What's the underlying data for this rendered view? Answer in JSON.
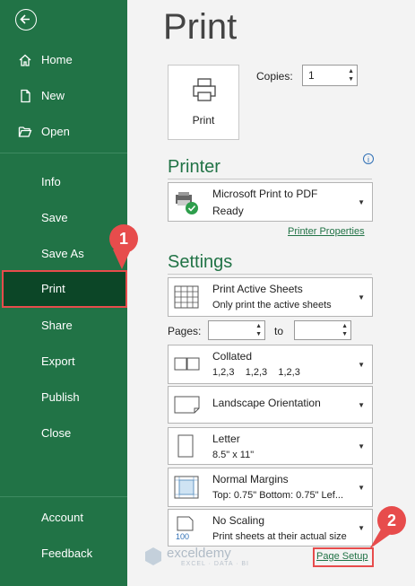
{
  "sidebar": {
    "back": "back",
    "items": [
      {
        "label": "Home",
        "icon": "home-icon"
      },
      {
        "label": "New",
        "icon": "new-document-icon"
      },
      {
        "label": "Open",
        "icon": "folder-open-icon"
      },
      {
        "label": "Info"
      },
      {
        "label": "Save"
      },
      {
        "label": "Save As"
      },
      {
        "label": "Print",
        "active": true
      },
      {
        "label": "Share"
      },
      {
        "label": "Export"
      },
      {
        "label": "Publish"
      },
      {
        "label": "Close"
      },
      {
        "label": "Account"
      },
      {
        "label": "Feedback"
      }
    ]
  },
  "main": {
    "title": "Print",
    "print_button": "Print",
    "copies_label": "Copies:",
    "copies_value": "1",
    "printer_heading": "Printer",
    "printer_name": "Microsoft Print to PDF",
    "printer_status": "Ready",
    "printer_properties": "Printer Properties",
    "settings_heading": "Settings",
    "settings": [
      {
        "line1": "Print Active Sheets",
        "line2": "Only print the active sheets"
      },
      {
        "line1": "Collated",
        "line2": "1,2,3    1,2,3    1,2,3"
      },
      {
        "line1": "Landscape Orientation",
        "line2": ""
      },
      {
        "line1": "Letter",
        "line2": "8.5\" x 11\""
      },
      {
        "line1": "Normal Margins",
        "line2": "Top: 0.75\" Bottom: 0.75\" Lef..."
      },
      {
        "line1": "No Scaling",
        "line2": "Print sheets at their actual size"
      }
    ],
    "pages_label": "Pages:",
    "to_label": "to",
    "page_setup": "Page Setup"
  },
  "badges": [
    "1",
    "2"
  ],
  "watermark": {
    "name": "exceldemy",
    "tagline": "EXCEL · DATA · BI"
  },
  "colors": {
    "accent": "#217346",
    "active": "#0c4627",
    "highlight": "#e74c4c"
  }
}
